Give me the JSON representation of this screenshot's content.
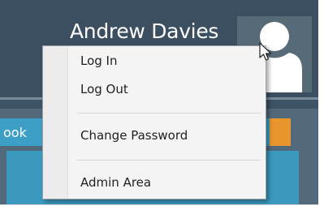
{
  "header": {
    "user_name": "Andrew Davies"
  },
  "avatar": {
    "icon": "user-silhouette-icon"
  },
  "background_tile": {
    "label_fragment": "ook"
  },
  "user_menu": {
    "items": [
      {
        "label": "Log In"
      },
      {
        "label": "Log Out"
      },
      {
        "label": "Change Password"
      },
      {
        "label": "Admin Area"
      }
    ]
  },
  "colors": {
    "header_bg": "#3c4f60",
    "tile_blue": "#3e9fc6",
    "tile_orange": "#e8952e",
    "menu_bg": "#f4f4f4"
  }
}
